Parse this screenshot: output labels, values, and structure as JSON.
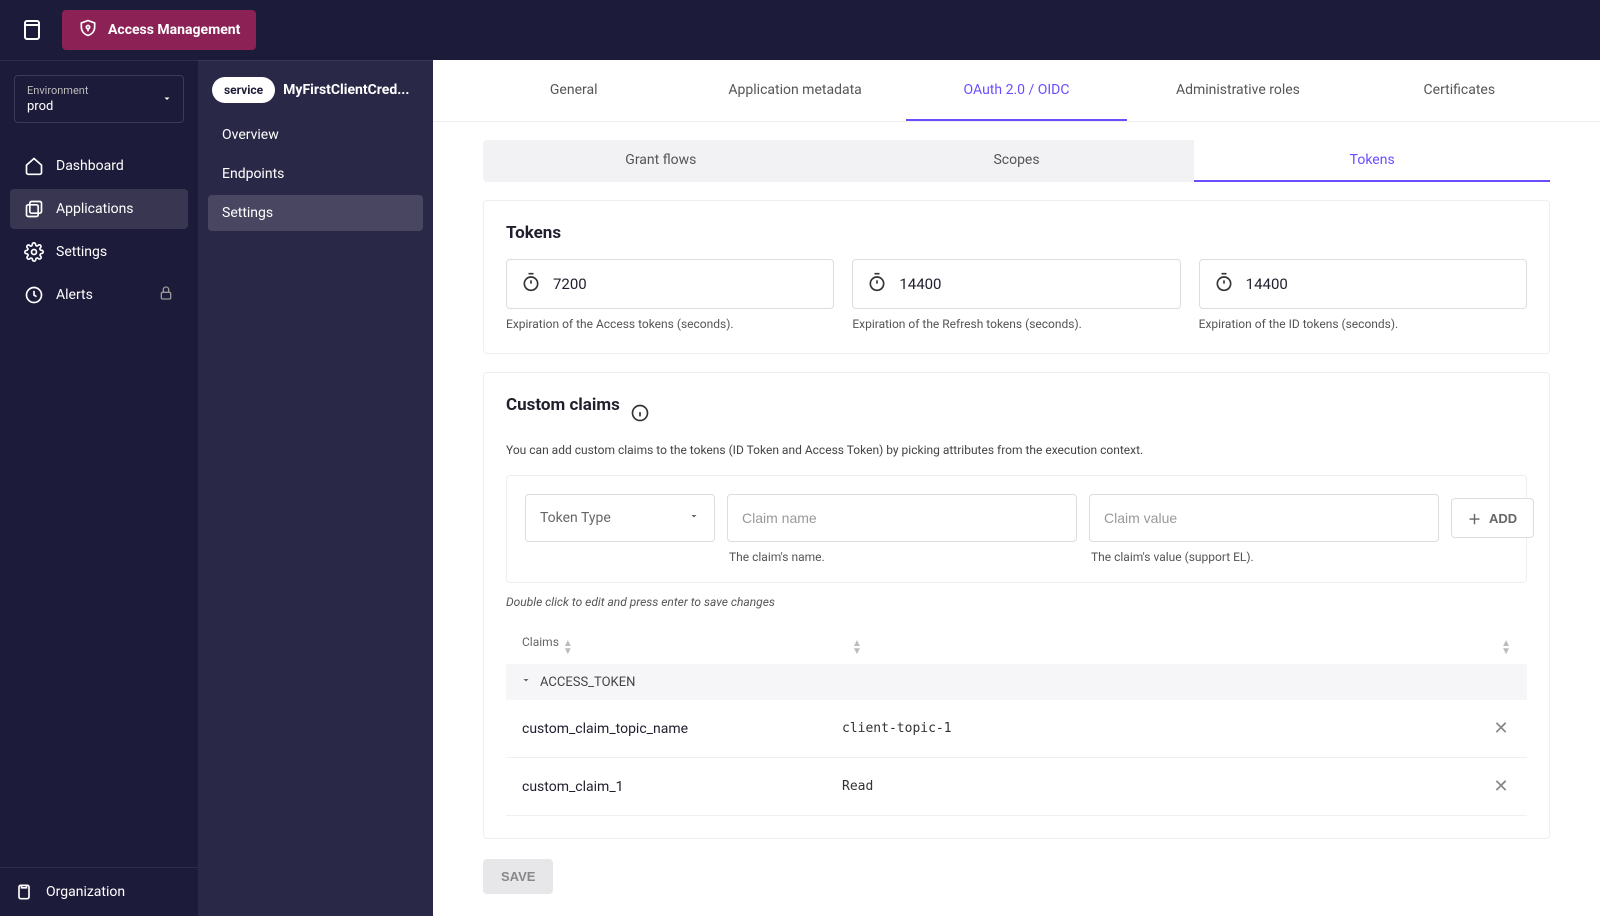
{
  "header": {
    "brand": "Access Management"
  },
  "sidebar1": {
    "env_label": "Environment",
    "env_value": "prod",
    "items": [
      {
        "label": "Dashboard"
      },
      {
        "label": "Applications"
      },
      {
        "label": "Settings"
      },
      {
        "label": "Alerts"
      }
    ],
    "org": "Organization"
  },
  "sidebar2": {
    "chip": "service",
    "app_name": "MyFirstClientCred...",
    "items": [
      {
        "label": "Overview"
      },
      {
        "label": "Endpoints"
      },
      {
        "label": "Settings"
      }
    ]
  },
  "tabs": {
    "main": [
      "General",
      "Application metadata",
      "OAuth 2.0 / OIDC",
      "Administrative roles",
      "Certificates"
    ],
    "sub": [
      "Grant flows",
      "Scopes",
      "Tokens"
    ]
  },
  "tokens": {
    "title": "Tokens",
    "items": [
      {
        "value": "7200",
        "help": "Expiration of the Access tokens (seconds)."
      },
      {
        "value": "14400",
        "help": "Expiration of the Refresh tokens (seconds)."
      },
      {
        "value": "14400",
        "help": "Expiration of the ID tokens (seconds)."
      }
    ]
  },
  "custom_claims": {
    "title": "Custom claims",
    "desc": "You can add custom claims to the tokens (ID Token and Access Token) by picking attributes from the execution context.",
    "token_type_label": "Token Type",
    "claim_name_placeholder": "Claim name",
    "claim_name_help": "The claim's name.",
    "claim_value_placeholder": "Claim value",
    "claim_value_help": "The claim's value (support EL).",
    "add_label": "ADD",
    "edit_hint": "Double click to edit and press enter to save changes",
    "table": {
      "header": "Claims",
      "group": "ACCESS_TOKEN",
      "rows": [
        {
          "name": "custom_claim_topic_name",
          "value": "client-topic-1"
        },
        {
          "name": "custom_claim_1",
          "value": "Read"
        }
      ]
    }
  },
  "save_label": "SAVE"
}
